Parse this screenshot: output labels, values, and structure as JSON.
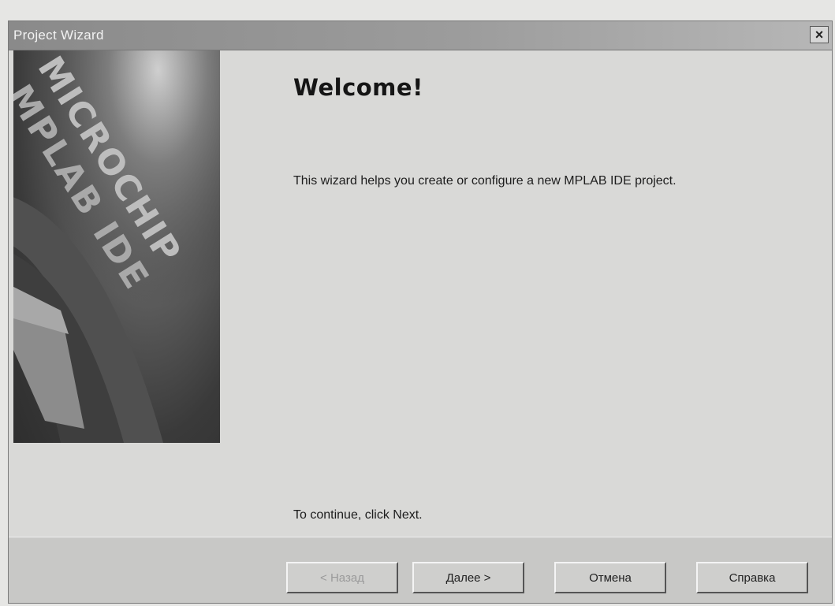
{
  "window": {
    "title": "Project Wizard",
    "close_glyph": "×"
  },
  "side_image": {
    "logo_line1": "MICROCHIP",
    "logo_line2": "MPLAB IDE"
  },
  "content": {
    "heading": "Welcome!",
    "description": "This wizard helps you create or configure a new MPLAB IDE project.",
    "continue_hint": "To continue, click Next."
  },
  "buttons": {
    "back": "< Назад",
    "next": "Далее >",
    "cancel": "Отмена",
    "help": "Справка"
  }
}
